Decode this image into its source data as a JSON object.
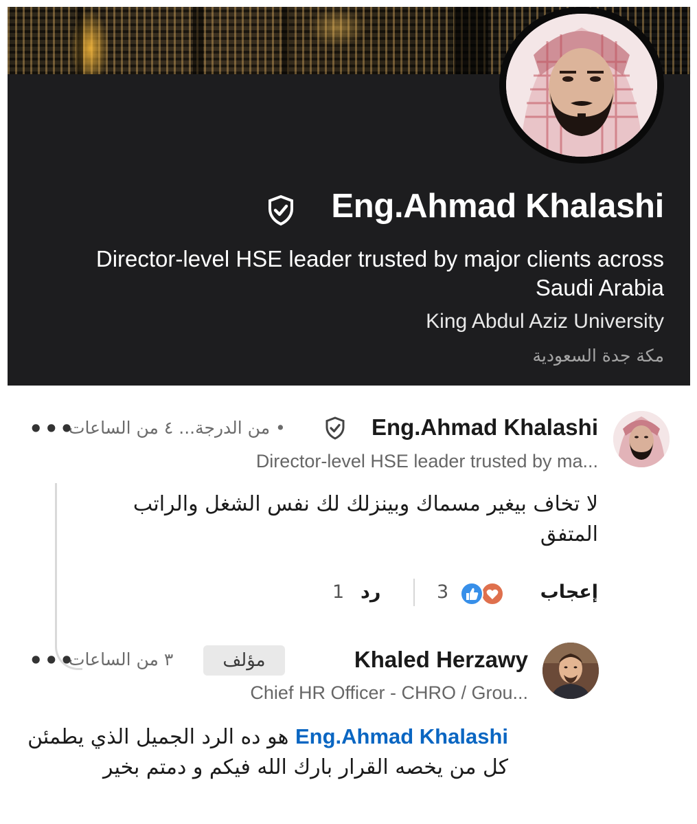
{
  "profile_card": {
    "name": "Eng.Ahmad Khalashi",
    "headline": "Director-level HSE leader trusted by major clients across Saudi Arabia",
    "education": "King Abdul Aziz University",
    "location": "مكة جدة السعودية",
    "verified_icon": "shield-check-icon"
  },
  "comment_1": {
    "author": "Eng.Ahmad Khalashi",
    "degree": "• من الدرجة...",
    "time": "٤ من الساعات",
    "headline": "Director-level HSE leader trusted by ma...",
    "body": "لا تخاف بيغير مسماك وبينزلك لك نفس الشغل والراتب المتفق",
    "like_label": "إعجاب",
    "like_count": "3",
    "reply_label": "رد",
    "reply_count": "1",
    "more_label": "•••"
  },
  "comment_2": {
    "author": "Khaled Herzawy",
    "author_badge": "مؤلف",
    "time": "٣ من الساعات",
    "headline": "Chief HR Officer - CHRO / Grou...",
    "mention": "Eng.Ahmad Khalashi",
    "body": "هو ده الرد الجميل الذي يطمئن كل من يخصه القرار بارك الله فيكم و دمتم بخير",
    "more_label": "•••"
  },
  "colors": {
    "card_bg": "#1d1d1f",
    "mention": "#0a66c2",
    "like_blue": "#378fe9",
    "love_red": "#df704d"
  }
}
